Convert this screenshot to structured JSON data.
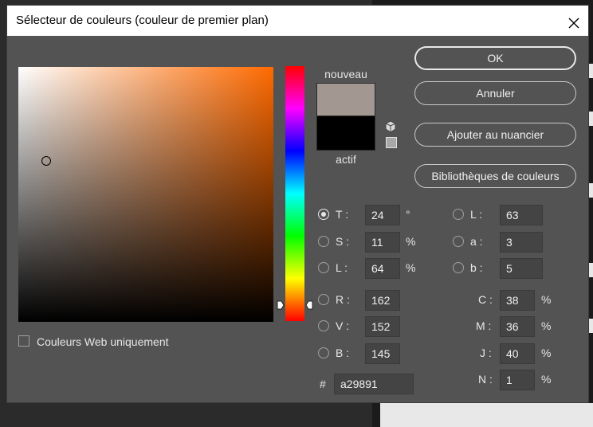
{
  "window": {
    "title": "Sélecteur de couleurs (couleur de premier plan)",
    "close_icon": "close-icon"
  },
  "preview": {
    "new_label": "nouveau",
    "current_label": "actif",
    "new_color": "#a29891",
    "current_color": "#000000"
  },
  "buttons": {
    "ok": "OK",
    "cancel": "Annuler",
    "add_swatch": "Ajouter au nuancier",
    "libraries": "Bibliothèques de couleurs"
  },
  "web_only": {
    "label": "Couleurs Web uniquement",
    "checked": false
  },
  "hsb": {
    "h": {
      "label": "T :",
      "value": "24",
      "unit": "°",
      "selected": true
    },
    "s": {
      "label": "S :",
      "value": "11",
      "unit": "%"
    },
    "b": {
      "label": "L :",
      "value": "64",
      "unit": "%"
    }
  },
  "rgb": {
    "r": {
      "label": "R :",
      "value": "162"
    },
    "g": {
      "label": "V :",
      "value": "152"
    },
    "b": {
      "label": "B :",
      "value": "145"
    }
  },
  "lab": {
    "l": {
      "label": "L :",
      "value": "63"
    },
    "a": {
      "label": "a :",
      "value": "3"
    },
    "b": {
      "label": "b :",
      "value": "5"
    }
  },
  "cmyk": {
    "c": {
      "label": "C :",
      "value": "38",
      "unit": "%"
    },
    "m": {
      "label": "M :",
      "value": "36",
      "unit": "%"
    },
    "y": {
      "label": "J :",
      "value": "40",
      "unit": "%"
    },
    "k": {
      "label": "N :",
      "value": "1",
      "unit": "%"
    }
  },
  "hex": {
    "label": "#",
    "value": "a29891"
  },
  "icons": {
    "gamut_warning": "cube-icon",
    "web_safe": "web-safe-swatch-icon"
  },
  "colors": {
    "dialog_bg": "#535353",
    "hue_base": "#ff6a00"
  }
}
